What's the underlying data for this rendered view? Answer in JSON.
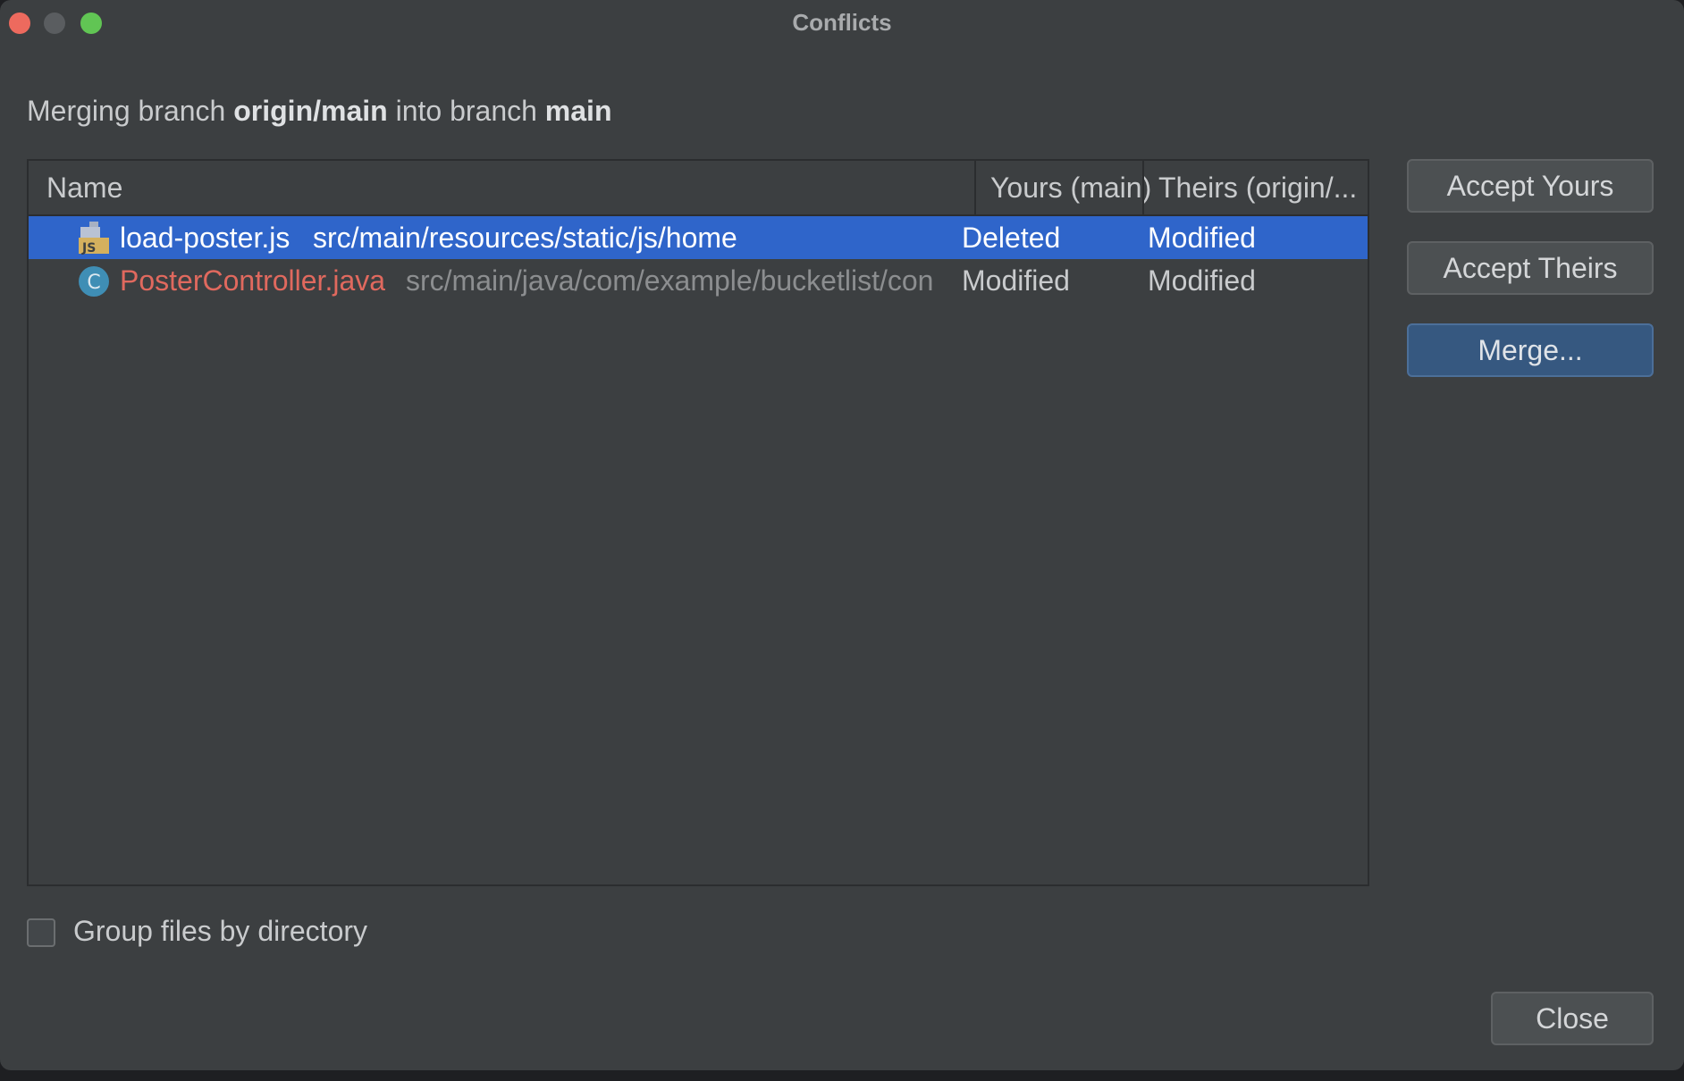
{
  "window": {
    "title": "Conflicts"
  },
  "description": {
    "prefix": "Merging branch ",
    "source_branch": "origin/main",
    "middle": " into branch ",
    "target_branch": "main"
  },
  "table": {
    "columns": {
      "name": "Name",
      "yours": "Yours (main)",
      "theirs": "Theirs (origin/..."
    },
    "rows": [
      {
        "icon": "js-file-icon",
        "file_name": "load-poster.js",
        "path": "src/main/resources/static/js/home",
        "yours": "Deleted",
        "theirs": "Modified",
        "selected": true
      },
      {
        "icon": "java-class-icon",
        "icon_letter": "C",
        "file_name": "PosterController.java",
        "path": "src/main/java/com/example/bucketlist/con",
        "yours": "Modified",
        "theirs": "Modified",
        "selected": false
      }
    ]
  },
  "buttons": {
    "accept_yours": "Accept Yours",
    "accept_theirs": "Accept Theirs",
    "merge": "Merge...",
    "close": "Close"
  },
  "options": {
    "group_by_directory_label": "Group files by directory",
    "group_by_directory_checked": false
  },
  "colors": {
    "selection": "#2f65ca",
    "conflict_file": "#e0695e",
    "primary_button": "#365880"
  }
}
